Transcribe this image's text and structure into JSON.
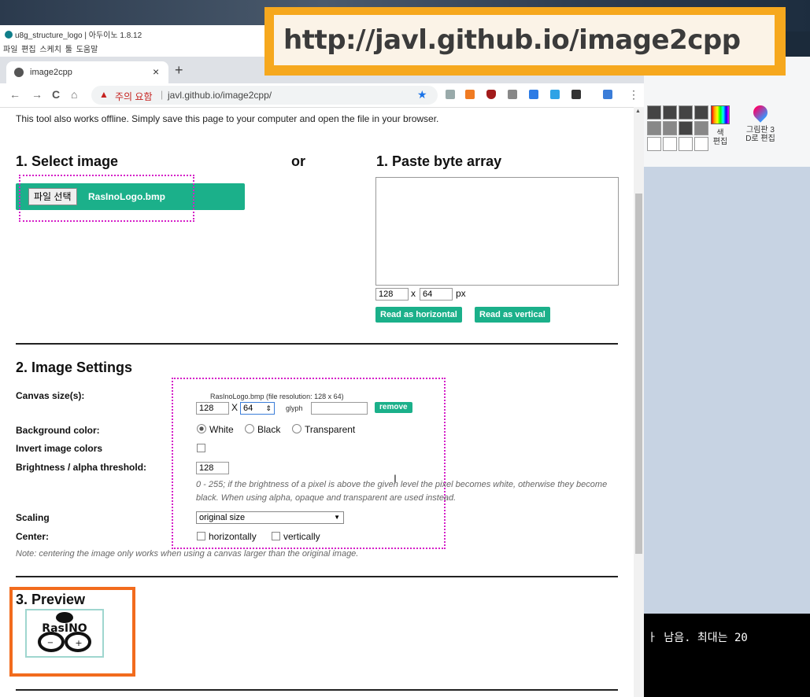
{
  "banner": {
    "url": "http://javl.github.io/image2cpp"
  },
  "arduino": {
    "title": "u8g_structure_logo | 아두이노 1.8.12",
    "menu": "파일 편집 스케치 툴 도움말"
  },
  "paint": {
    "color_label": "색\n편집",
    "paint3d_label": "그림판 3\nD로 편집"
  },
  "console": {
    "line1": "",
    "line2": "ㅏ 남음.  최대는 20"
  },
  "browser": {
    "tab_title": "image2cpp",
    "tab_close": "×",
    "new_tab": "+",
    "security_label": "주의 요함",
    "address": "javl.github.io/image2cpp/",
    "back": "←",
    "forward": "→",
    "reload": "C",
    "home": "⌂",
    "star": "★",
    "menu": "⋮"
  },
  "page": {
    "offline_note": "This tool also works offline. Simply save this page to your computer and open the file in your browser.",
    "select_heading": "1. Select image",
    "or": "or",
    "paste_heading": "1. Paste byte array",
    "file_button": "파일 선택",
    "file_name": "RasInoLogo.bmp",
    "paste_width": "128",
    "paste_x": "x",
    "paste_height": "64",
    "paste_px": "px",
    "read_horizontal": "Read as horizontal",
    "read_vertical": "Read as vertical",
    "settings_heading": "2. Image Settings",
    "canvas_label": "Canvas size(s):",
    "canvas_file_info": "RasInoLogo.bmp  (file resolution: 128 x 64)",
    "canvas_width": "128",
    "canvas_x": "X",
    "canvas_height": "64",
    "glyph_label": "glyph",
    "remove": "remove",
    "bg_label": "Background color:",
    "bg_white": "White",
    "bg_black": "Black",
    "bg_transparent": "Transparent",
    "invert_label": "Invert image colors",
    "threshold_label": "Brightness / alpha threshold:",
    "threshold_value": "128",
    "threshold_note": "0 - 255; if the brightness of a pixel is above the given level the pixel becomes white, otherwise they become black. When using alpha, opaque and transparent are used instead.",
    "scaling_label": "Scaling",
    "scaling_value": "original size",
    "center_label": "Center:",
    "center_h": "horizontally",
    "center_v": "vertically",
    "center_note": "Note: centering the image only works when using a canvas larger than the original image.",
    "preview_heading": "3. Preview",
    "preview_logo_text": "RasINO"
  },
  "colors": {
    "teal": "#1bb08a",
    "banner_orange": "#f6a81e",
    "highlight_magenta": "#d520c8",
    "preview_orange": "#f26b1d"
  }
}
